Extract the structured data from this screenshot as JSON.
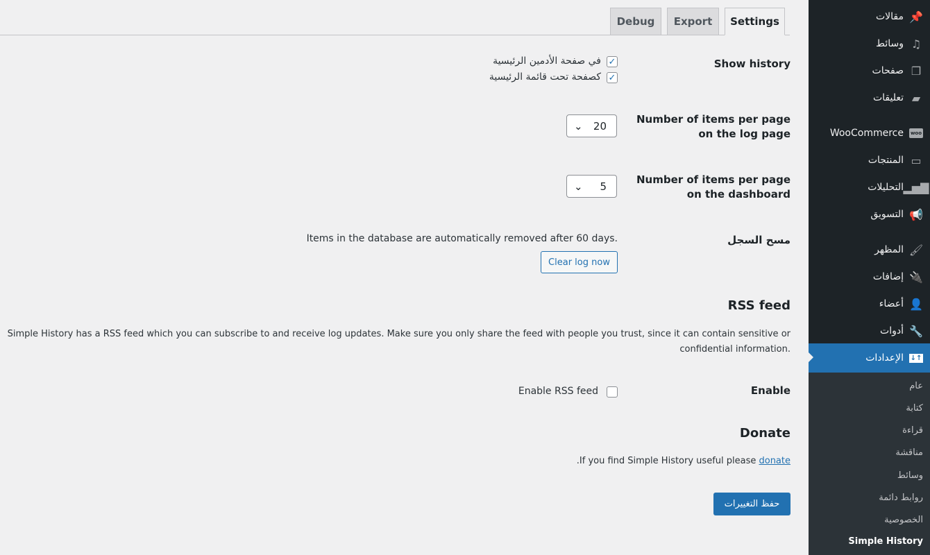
{
  "sidebar": {
    "items": [
      {
        "label": "مقالات",
        "icon": "pin-icon"
      },
      {
        "label": "وسائط",
        "icon": "media-icon"
      },
      {
        "label": "صفحات",
        "icon": "pages-icon"
      },
      {
        "label": "تعليقات",
        "icon": "comments-icon"
      },
      {
        "label": "WooCommerce",
        "icon": "woo-icon"
      },
      {
        "label": "المنتجات",
        "icon": "archive-icon"
      },
      {
        "label": "التحليلات",
        "icon": "chart-bar-icon"
      },
      {
        "label": "التسويق",
        "icon": "megaphone-icon"
      },
      {
        "label": "المظهر",
        "icon": "brush-icon"
      },
      {
        "label": "إضافات",
        "icon": "plugin-icon"
      },
      {
        "label": "أعضاء",
        "icon": "user-icon"
      },
      {
        "label": "أدوات",
        "icon": "wrench-icon"
      },
      {
        "label": "الإعدادات",
        "icon": "settings-icon"
      }
    ],
    "submenu": [
      "عام",
      "كتابة",
      "قراءة",
      "مناقشة",
      "وسائط",
      "روابط دائمة",
      "الخصوصية",
      "Simple History"
    ]
  },
  "tabs": [
    "Debug",
    "Export",
    "Settings"
  ],
  "show_history": {
    "label": "Show history",
    "options": [
      {
        "label": "في صفحة الأدمين الرئيسية",
        "checked": true
      },
      {
        "label": "كصفحة تحت قائمة الرئيسية",
        "checked": true
      }
    ]
  },
  "log_page": {
    "label_1": "Number of items per page",
    "label_2": "on the log page",
    "value": "20"
  },
  "dashboard": {
    "label_1": "Number of items per page",
    "label_2": "on the dashboard",
    "value": "5"
  },
  "clear": {
    "label": "مسح السجل",
    "text": "Items in the database are automatically removed after 60 days.",
    "button": "Clear log now"
  },
  "rss": {
    "heading": "RSS feed",
    "description_1": "Simple History has a RSS feed which you can subscribe to and receive log updates. Make sure you only share the feed with people you trust, since it can contain sensitive or",
    "description_2": "confidential information.",
    "enable_label": "Enable",
    "checkbox_label": "Enable RSS feed",
    "checked": false
  },
  "donate": {
    "heading": "Donate",
    "text": "If you find Simple History useful please ",
    "link": "donate",
    "end": "."
  },
  "save": "حفظ التغييرات",
  "colors": {
    "accent": "#2271b1",
    "sidebar": "#1d2327"
  }
}
